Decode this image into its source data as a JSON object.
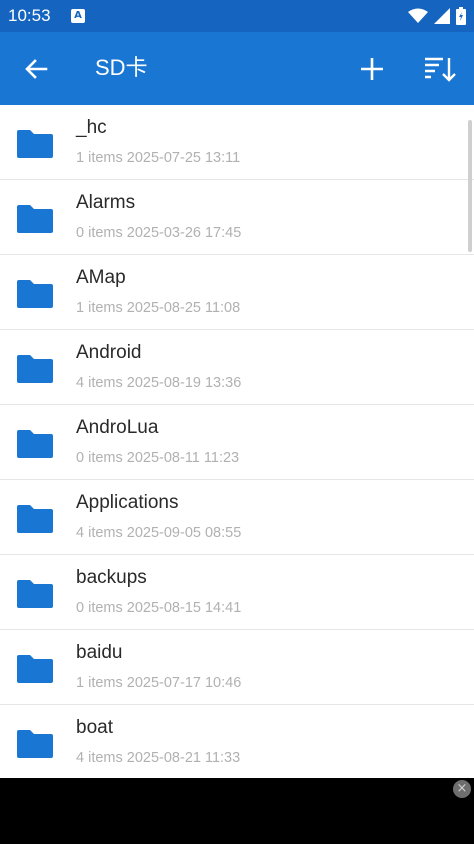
{
  "status_bar": {
    "time": "10:53",
    "notification_icon": "A",
    "icons": [
      "wifi-icon",
      "signal-icon",
      "battery-icon"
    ]
  },
  "app_bar": {
    "title": "SD卡",
    "back_icon": "arrow-left-icon",
    "add_icon": "plus-icon",
    "sort_icon": "sort-icon",
    "background": "#1976d2"
  },
  "folders": [
    {
      "name": "_hc",
      "count": "1 items",
      "date": "2025-07-25 13:11"
    },
    {
      "name": "Alarms",
      "count": "0 items",
      "date": "2025-03-26 17:45"
    },
    {
      "name": "AMap",
      "count": "1 items",
      "date": "2025-08-25 11:08"
    },
    {
      "name": "Android",
      "count": "4 items",
      "date": "2025-08-19 13:36"
    },
    {
      "name": "AndroLua",
      "count": "0 items",
      "date": "2025-08-11 11:23"
    },
    {
      "name": "Applications",
      "count": "4 items",
      "date": "2025-09-05 08:55"
    },
    {
      "name": "backups",
      "count": "0 items",
      "date": "2025-08-15 14:41"
    },
    {
      "name": "baidu",
      "count": "1 items",
      "date": "2025-07-17 10:46"
    },
    {
      "name": "boat",
      "count": "4 items",
      "date": "2025-08-21 11:33"
    }
  ],
  "colors": {
    "status_bar": "#1565c0",
    "accent": "#1976d2",
    "folder": "#1976d2",
    "meta_text": "#b1b1b1"
  },
  "ad_close_label": "×"
}
